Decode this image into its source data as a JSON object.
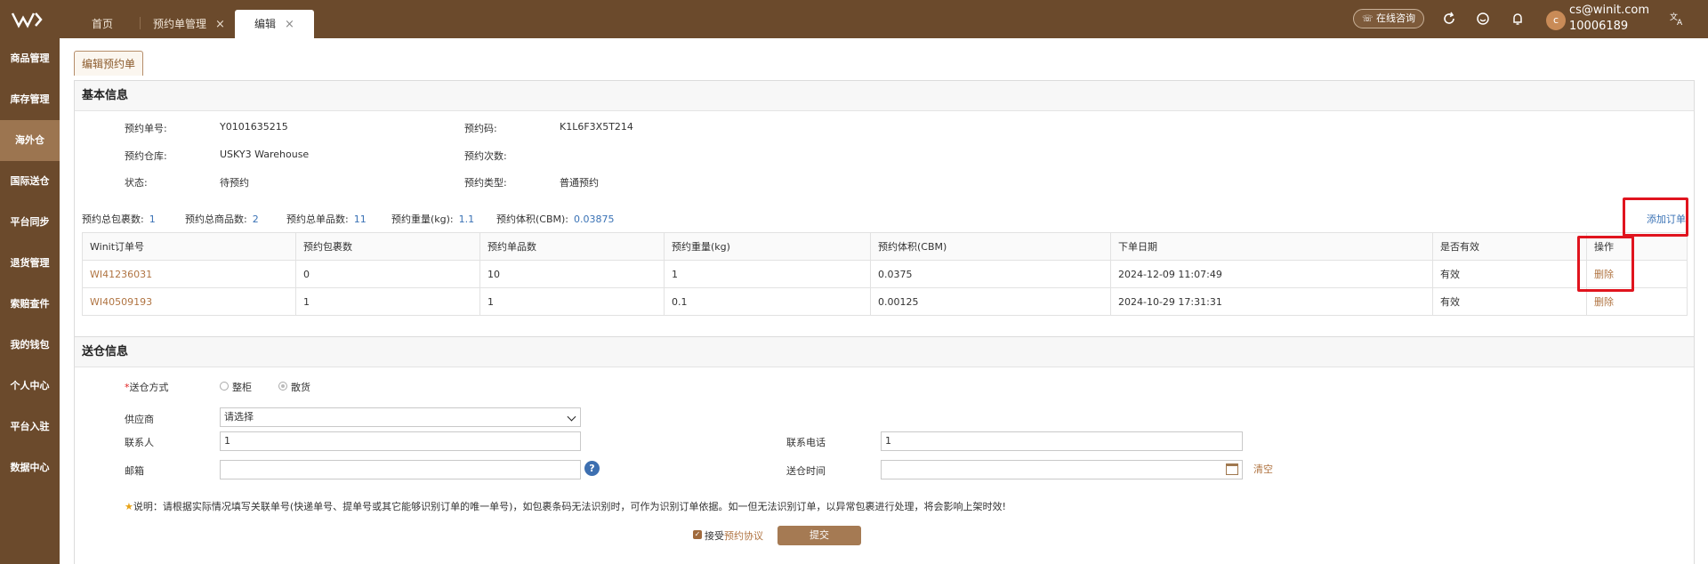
{
  "topbar": {
    "tabs": [
      {
        "label": "首页",
        "closable": false
      },
      {
        "label": "预约单管理",
        "closable": true
      },
      {
        "label": "编辑",
        "closable": true,
        "active": true
      }
    ],
    "close_glyph": "×",
    "consult_label": "在线咨询",
    "icons": [
      "refresh-icon",
      "smile-icon",
      "bell-icon",
      "translate-icon"
    ],
    "avatar_letter": "c",
    "user_email": "cs@winit.com",
    "user_id": "10006189"
  },
  "sidebar": {
    "items": [
      {
        "label": "商品管理"
      },
      {
        "label": "库存管理"
      },
      {
        "label": "海外仓",
        "active": true
      },
      {
        "label": "国际送仓"
      },
      {
        "label": "平台同步"
      },
      {
        "label": "退货管理"
      },
      {
        "label": "索赔查件"
      },
      {
        "label": "我的钱包"
      },
      {
        "label": "个人中心"
      },
      {
        "label": "平台入驻"
      },
      {
        "label": "数据中心"
      }
    ]
  },
  "page_tab": "编辑预约单",
  "basic": {
    "title": "基本信息",
    "fields": {
      "order_no_label": "预约单号:",
      "order_no": "Y0101635215",
      "code_label": "预约码:",
      "code": "K1L6F3X5T214",
      "warehouse_label": "预约仓库:",
      "warehouse": "USKY3 Warehouse",
      "count_label": "预约次数:",
      "count": "",
      "status_label": "状态:",
      "status": "待预约",
      "type_label": "预约类型:",
      "type": "普通预约"
    },
    "stats": [
      {
        "label": "预约总包裹数:",
        "value": "1"
      },
      {
        "label": "预约总商品数:",
        "value": "2"
      },
      {
        "label": "预约总单品数:",
        "value": "11"
      },
      {
        "label": "预约重量(kg):",
        "value": "1.1"
      },
      {
        "label": "预约体积(CBM):",
        "value": "0.03875"
      }
    ],
    "add_order": "添加订单",
    "table": {
      "headers": [
        "Winit订单号",
        "预约包裹数",
        "预约单品数",
        "预约重量(kg)",
        "预约体积(CBM)",
        "下单日期",
        "是否有效",
        "操作"
      ],
      "rows": [
        [
          "WI41236031",
          "0",
          "10",
          "1",
          "0.0375",
          "2024-12-09 11:07:49",
          "有效",
          "删除"
        ],
        [
          "WI40509193",
          "1",
          "1",
          "0.1",
          "0.00125",
          "2024-10-29 17:31:31",
          "有效",
          "删除"
        ]
      ]
    }
  },
  "delivery": {
    "title": "送仓信息",
    "method_label": "送仓方式",
    "method_required": "*",
    "method_options": [
      "整柜",
      "散货"
    ],
    "method_selected": "散货",
    "supplier_label": "供应商",
    "supplier_value": "请选择",
    "contact_label": "联系人",
    "contact_value": "1",
    "phone_label": "联系电话",
    "phone_value": "1",
    "mailbox_label": "邮箱",
    "mailbox_value": "",
    "help_glyph": "?",
    "time_label": "送仓时间",
    "time_value": "",
    "clear_label": "清空",
    "note_star": "★",
    "note": "说明：请根据实际情况填写关联单号(快递单号、提单号或其它能够识别订单的唯一单号)，如包裹条码无法识别时，可作为识别订单依据。如一但无法识别订单，以异常包裹进行处理，将会影响上架时效!",
    "agree_prefix": "接受",
    "agree_link": "预约协议",
    "agree_checked": true,
    "check_glyph": "✓",
    "submit_label": "提交"
  }
}
